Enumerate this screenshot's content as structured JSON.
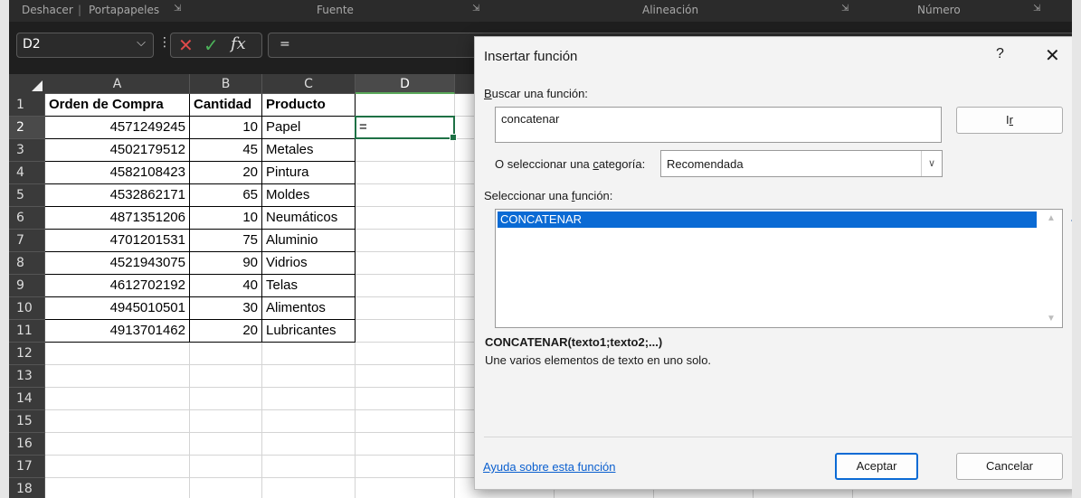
{
  "ribbon": {
    "groups": [
      "Deshacer",
      "Portapapeles",
      "Fuente",
      "Alineación",
      "Número"
    ],
    "launcher": "⇲"
  },
  "formula_bar": {
    "name_box": "D2",
    "cancel_icon": "✕",
    "enter_icon": "✓",
    "fx_label": "fx",
    "content": "="
  },
  "sheet": {
    "columns": [
      "A",
      "B",
      "C",
      "D"
    ],
    "rows": [
      "1",
      "2",
      "3",
      "4",
      "5",
      "6",
      "7",
      "8",
      "9",
      "10",
      "11",
      "12",
      "13",
      "14",
      "15",
      "16",
      "17",
      "18"
    ],
    "active_cell": "D2",
    "active_cell_value": "=",
    "header": [
      "Orden de Compra",
      "Cantidad",
      "Producto"
    ],
    "data": [
      [
        "4571249245",
        "10",
        "Papel"
      ],
      [
        "4502179512",
        "45",
        "Metales"
      ],
      [
        "4582108423",
        "20",
        "Pintura"
      ],
      [
        "4532862171",
        "65",
        "Moldes"
      ],
      [
        "4871351206",
        "10",
        "Neumáticos"
      ],
      [
        "4701201531",
        "75",
        "Aluminio"
      ],
      [
        "4521943075",
        "90",
        "Vidrios"
      ],
      [
        "4612702192",
        "40",
        "Telas"
      ],
      [
        "4945010501",
        "30",
        "Alimentos"
      ],
      [
        "4913701462",
        "20",
        "Lubricantes"
      ]
    ]
  },
  "dialog": {
    "title": "Insertar función",
    "help_icon": "?",
    "close_icon": "✕",
    "search_label": "Buscar una función:",
    "search_value": "concatenar",
    "go_button": "Ir",
    "category_label": "O seleccionar una categoría:",
    "category_value": "Recomendada",
    "functions_label": "Seleccionar una función:",
    "functions": [
      "CONCATENAR"
    ],
    "signature": "CONCATENAR(texto1;texto2;...)",
    "description": "Une varios elementos de texto en uno solo.",
    "help_link": "Ayuda sobre esta función",
    "ok_button": "Aceptar",
    "cancel_button": "Cancelar"
  },
  "colors": {
    "accent": "#0a6ad4",
    "selection_border": "#1e7145",
    "link": "#0a5fcf"
  }
}
